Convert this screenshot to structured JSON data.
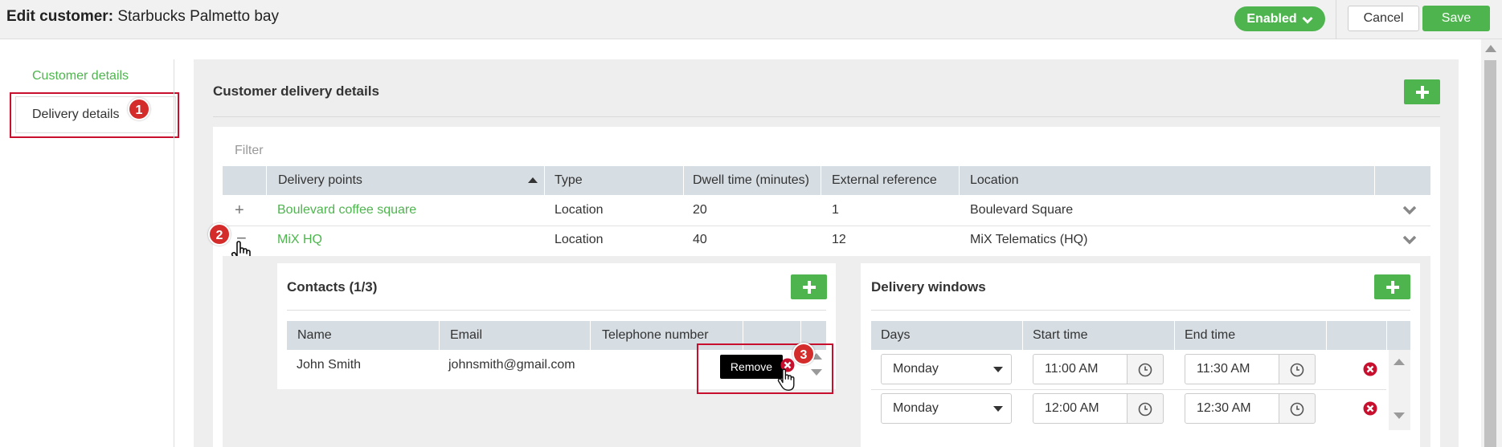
{
  "header": {
    "title_prefix": "Edit customer:",
    "title_name": "Starbucks Palmetto bay",
    "status_label": "Enabled",
    "cancel_label": "Cancel",
    "save_label": "Save"
  },
  "sidebar": {
    "items": [
      {
        "label": "Customer details",
        "active": false
      },
      {
        "label": "Delivery details",
        "active": true
      }
    ]
  },
  "annotations": {
    "badge1": "1",
    "badge2": "2",
    "badge3": "3"
  },
  "main": {
    "section_title": "Customer delivery details",
    "filter_placeholder": "Filter",
    "table": {
      "columns": [
        "Delivery points",
        "Type",
        "Dwell time (minutes)",
        "External reference",
        "Location"
      ],
      "rows": [
        {
          "expand_symbol": "+",
          "point": "Boulevard coffee square",
          "type": "Location",
          "dwell": "20",
          "ext_ref": "1",
          "location": "Boulevard Square"
        },
        {
          "expand_symbol": "−",
          "point": "MiX HQ",
          "type": "Location",
          "dwell": "40",
          "ext_ref": "12",
          "location": "MiX Telematics (HQ)"
        }
      ]
    },
    "contacts": {
      "title": "Contacts (1/3)",
      "columns": [
        "Name",
        "Email",
        "Telephone number"
      ],
      "rows": [
        {
          "name": "John Smith",
          "email": "johnsmith@gmail.com",
          "phone": ""
        }
      ],
      "tooltip": "Remove"
    },
    "delivery_windows": {
      "title": "Delivery windows",
      "columns": [
        "Days",
        "Start time",
        "End time"
      ],
      "rows": [
        {
          "day": "Monday",
          "start": "11:00 AM",
          "end": "11:30 AM"
        },
        {
          "day": "Monday",
          "start": "12:00 AM",
          "end": "12:30 AM"
        }
      ]
    }
  },
  "colors": {
    "accent_green": "#4eb54e",
    "annotation_red": "#c8102e",
    "header_gray": "#d6dde3"
  }
}
